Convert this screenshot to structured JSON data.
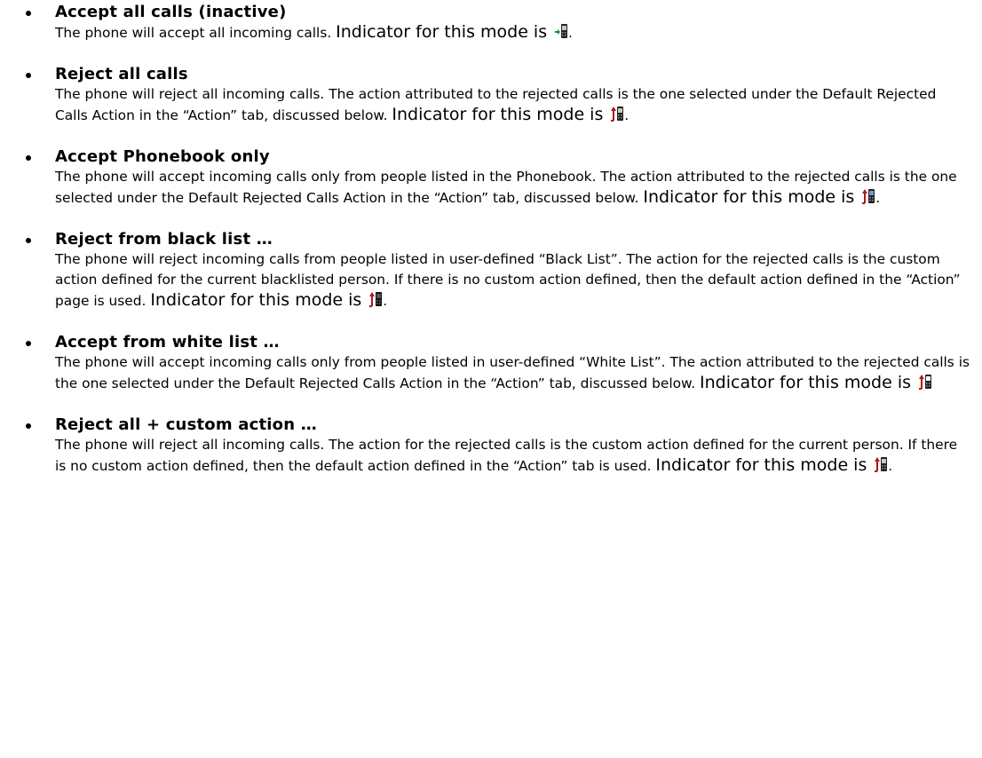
{
  "document": {
    "items": [
      {
        "title": "Accept all calls (inactive)",
        "description": "The phone will accept all incoming calls.",
        "indicator_label": "Indicator for this mode is",
        "indicator_icon": "phone-accept-icon",
        "trailing": "."
      },
      {
        "title": "Reject all calls",
        "description": "The phone will reject all incoming calls. The action attributed to the rejected calls is the one selected under the Default Rejected Calls Action in the “Action” tab, discussed below.",
        "indicator_label": "Indicator for this mode is",
        "indicator_icon": "phone-reject-icon",
        "trailing": "."
      },
      {
        "title": "Accept Phonebook only",
        "description": "The phone will accept incoming calls only from people listed in the Phonebook. The action attributed to the rejected calls is the one selected under the Default Rejected Calls Action in the “Action” tab, discussed below.",
        "indicator_label": "Indicator for this mode is",
        "indicator_icon": "phone-phonebook-icon",
        "trailing": "."
      },
      {
        "title": "Reject from black list …",
        "description": "The phone will reject incoming calls from people listed in user-defined “Black List”. The action for the rejected calls is the custom action defined for the current blacklisted person. If there is no custom action defined, then the default action defined in the “Action” page is used.",
        "indicator_label": "Indicator for this mode is",
        "indicator_icon": "phone-blacklist-icon",
        "trailing": "."
      },
      {
        "title": "Accept from white list …",
        "description": "The phone will accept incoming calls only from people listed in user-defined “White List”. The action attributed to the rejected calls is the one selected under the Default Rejected Calls Action in the “Action” tab, discussed below.",
        "indicator_label": "Indicator for this mode is",
        "indicator_icon": "phone-whitelist-icon",
        "trailing": ""
      },
      {
        "title": "Reject all + custom action …",
        "description": "The phone will reject all incoming calls. The action for the rejected calls is the custom action defined for the current person. If there is no custom action defined, then the default action defined in the “Action” tab is used.",
        "indicator_label": "Indicator for this mode is",
        "indicator_icon": "phone-reject-custom-icon",
        "trailing": "."
      }
    ]
  },
  "colors": {
    "accept_arrow": "#1f8f2a",
    "reject_arrow": "#b01818",
    "phone_body": "#222222",
    "phone_screen": "#c8c8c8"
  }
}
